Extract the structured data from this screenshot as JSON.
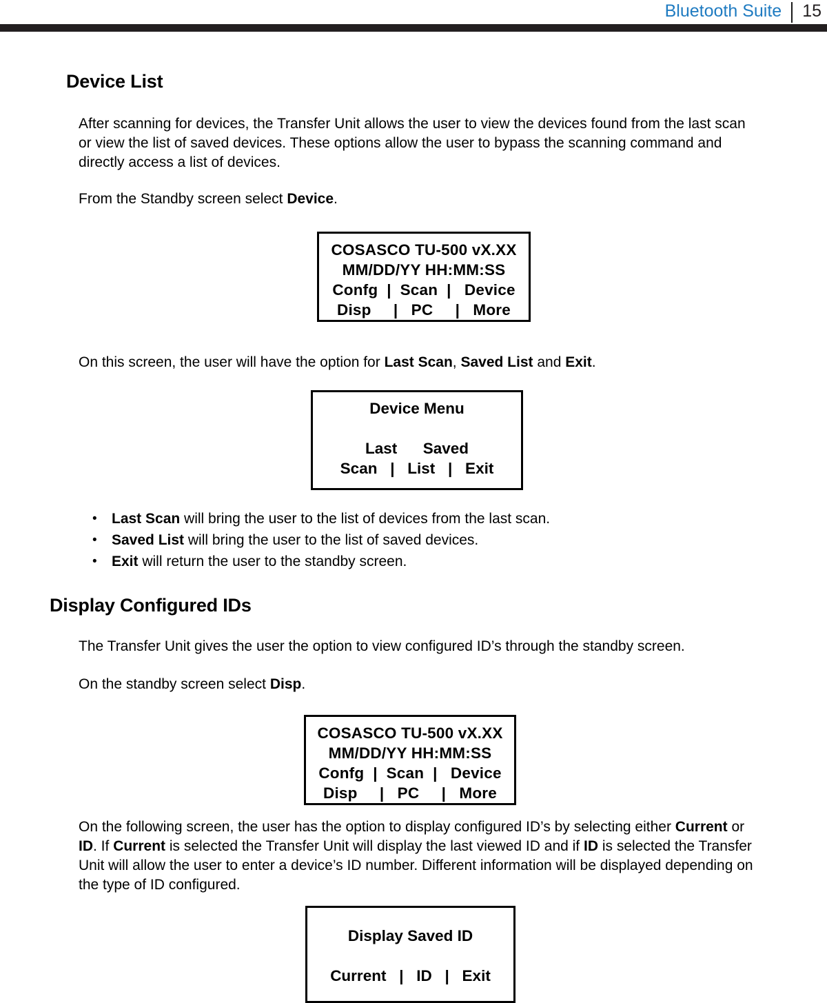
{
  "header": {
    "title": "Bluetooth Suite",
    "page_number": "15"
  },
  "sections": [
    {
      "heading": "Device List",
      "paragraphs": [
        "After scanning for devices, the Transfer Unit allows the user to view the devices found from the last scan or view the list of saved devices. These options allow the user to bypass the scanning command and directly access a list of devices.",
        "From the Standby screen select Device.",
        "On this screen, the user will have the option for Last Scan, Saved List and Exit."
      ]
    },
    {
      "heading": "Display Configured IDs",
      "paragraphs": [
        "The Transfer Unit gives the user the option to view configured ID’s through the standby screen.",
        "On the standby screen select Disp.",
        "On the following screen, the user has the option to display configured ID’s by selecting either Current or ID. If Current is selected the Transfer Unit will display the last viewed ID and if ID is selected the Transfer Unit will allow the user to enter a device’s ID number. Different information will be displayed depending on the type of ID configured."
      ]
    }
  ],
  "paragraph_parts": {
    "p2_prefix": "From the Standby screen select ",
    "p2_bold": "Device",
    "p2_suffix": ".",
    "p3_prefix": "On this screen, the user will have the option for ",
    "p3_bold1": "Last Scan",
    "p3_mid1": ", ",
    "p3_bold2": "Saved List",
    "p3_mid2": " and ",
    "p3_bold3": "Exit",
    "p3_suffix": ".",
    "p5_prefix": "On the standby screen select ",
    "p5_bold": "Disp",
    "p5_suffix": ".",
    "p6_a": "On the following screen, the user has the option to display configured ID’s by selecting either ",
    "p6_b1": "Current",
    "p6_b": " or ",
    "p6_b2": "ID",
    "p6_c": ". If ",
    "p6_b3": "Current",
    "p6_d": " is selected the Transfer Unit will display the last viewed ID and if ",
    "p6_b4": "ID",
    "p6_e": " is selected the Transfer Unit will allow the user to enter a device’s ID number. Different information will be displayed depending on the type of ID configured."
  },
  "bullets": [
    {
      "term": "Last Scan",
      "text": " will bring the user to the list of devices from the last scan."
    },
    {
      "term": "Saved List",
      "text": " will bring the user to the list of saved devices."
    },
    {
      "term": "Exit",
      "text": " will return the user to the standby screen."
    }
  ],
  "lcd_screens": {
    "standby": {
      "line1": "COSASCO TU-500 vX.XX",
      "line2": "MM/DD/YY HH:MM:SS",
      "line3": "Confg  |  Scan  |   Device",
      "line4": "Disp     |   PC     |   More"
    },
    "device_menu": {
      "line1": "Device Menu",
      "line2": " ",
      "line3": "Last      Saved",
      "line4": "Scan   |   List   |   Exit"
    },
    "display_saved_id": {
      "line1": "Display Saved ID",
      "line2": " ",
      "line3": "Current   |   ID   |   Exit"
    }
  }
}
